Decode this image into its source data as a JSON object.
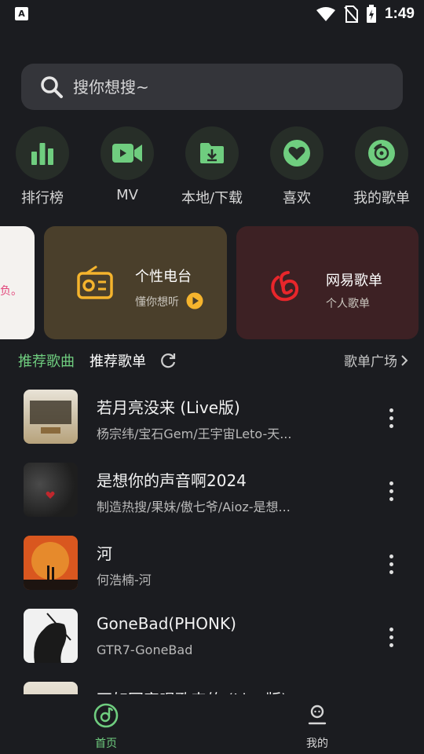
{
  "status_bar": {
    "time": "1:49",
    "app_icon": "A"
  },
  "search": {
    "placeholder": "搜你想搜~"
  },
  "quick_actions": [
    {
      "label": "排行榜",
      "icon": "bar-chart-icon"
    },
    {
      "label": "MV",
      "icon": "video-camera-icon"
    },
    {
      "label": "本地/下载",
      "icon": "folder-download-icon"
    },
    {
      "label": "喜欢",
      "icon": "heart-icon"
    },
    {
      "label": "我的歌单",
      "icon": "disc-icon"
    }
  ],
  "cards": {
    "partial_text": "自负。",
    "radio": {
      "title": "个性电台",
      "subtitle": "懂你想听",
      "icon": "radio-icon"
    },
    "netease": {
      "title": "网易歌单",
      "subtitle": "个人歌单",
      "icon": "netease-logo-icon"
    }
  },
  "tabs": {
    "recommended_songs": "推荐歌曲",
    "recommended_playlists": "推荐歌单",
    "plaza": "歌单广场"
  },
  "songs": [
    {
      "title": "若月亮没来 (Live版)",
      "artist": "杨宗纬/宝石Gem/王宇宙Leto-天..."
    },
    {
      "title": "是想你的声音啊2024",
      "artist": "制造热搜/果妹/傲七爷/Aioz-是想..."
    },
    {
      "title": "河",
      "artist": "何浩楠-河"
    },
    {
      "title": "GoneBad(PHONK)",
      "artist": "GTR7-GoneBad"
    },
    {
      "title": "不如回家唱歌来的 (Live版)",
      "artist": ""
    }
  ],
  "bottom_nav": {
    "home": "首页",
    "mine": "我的"
  },
  "colors": {
    "accent": "#6fcd7f",
    "background": "#1b1c20",
    "radio_card": "#4a3f2b",
    "netease_card": "#3d2124"
  }
}
